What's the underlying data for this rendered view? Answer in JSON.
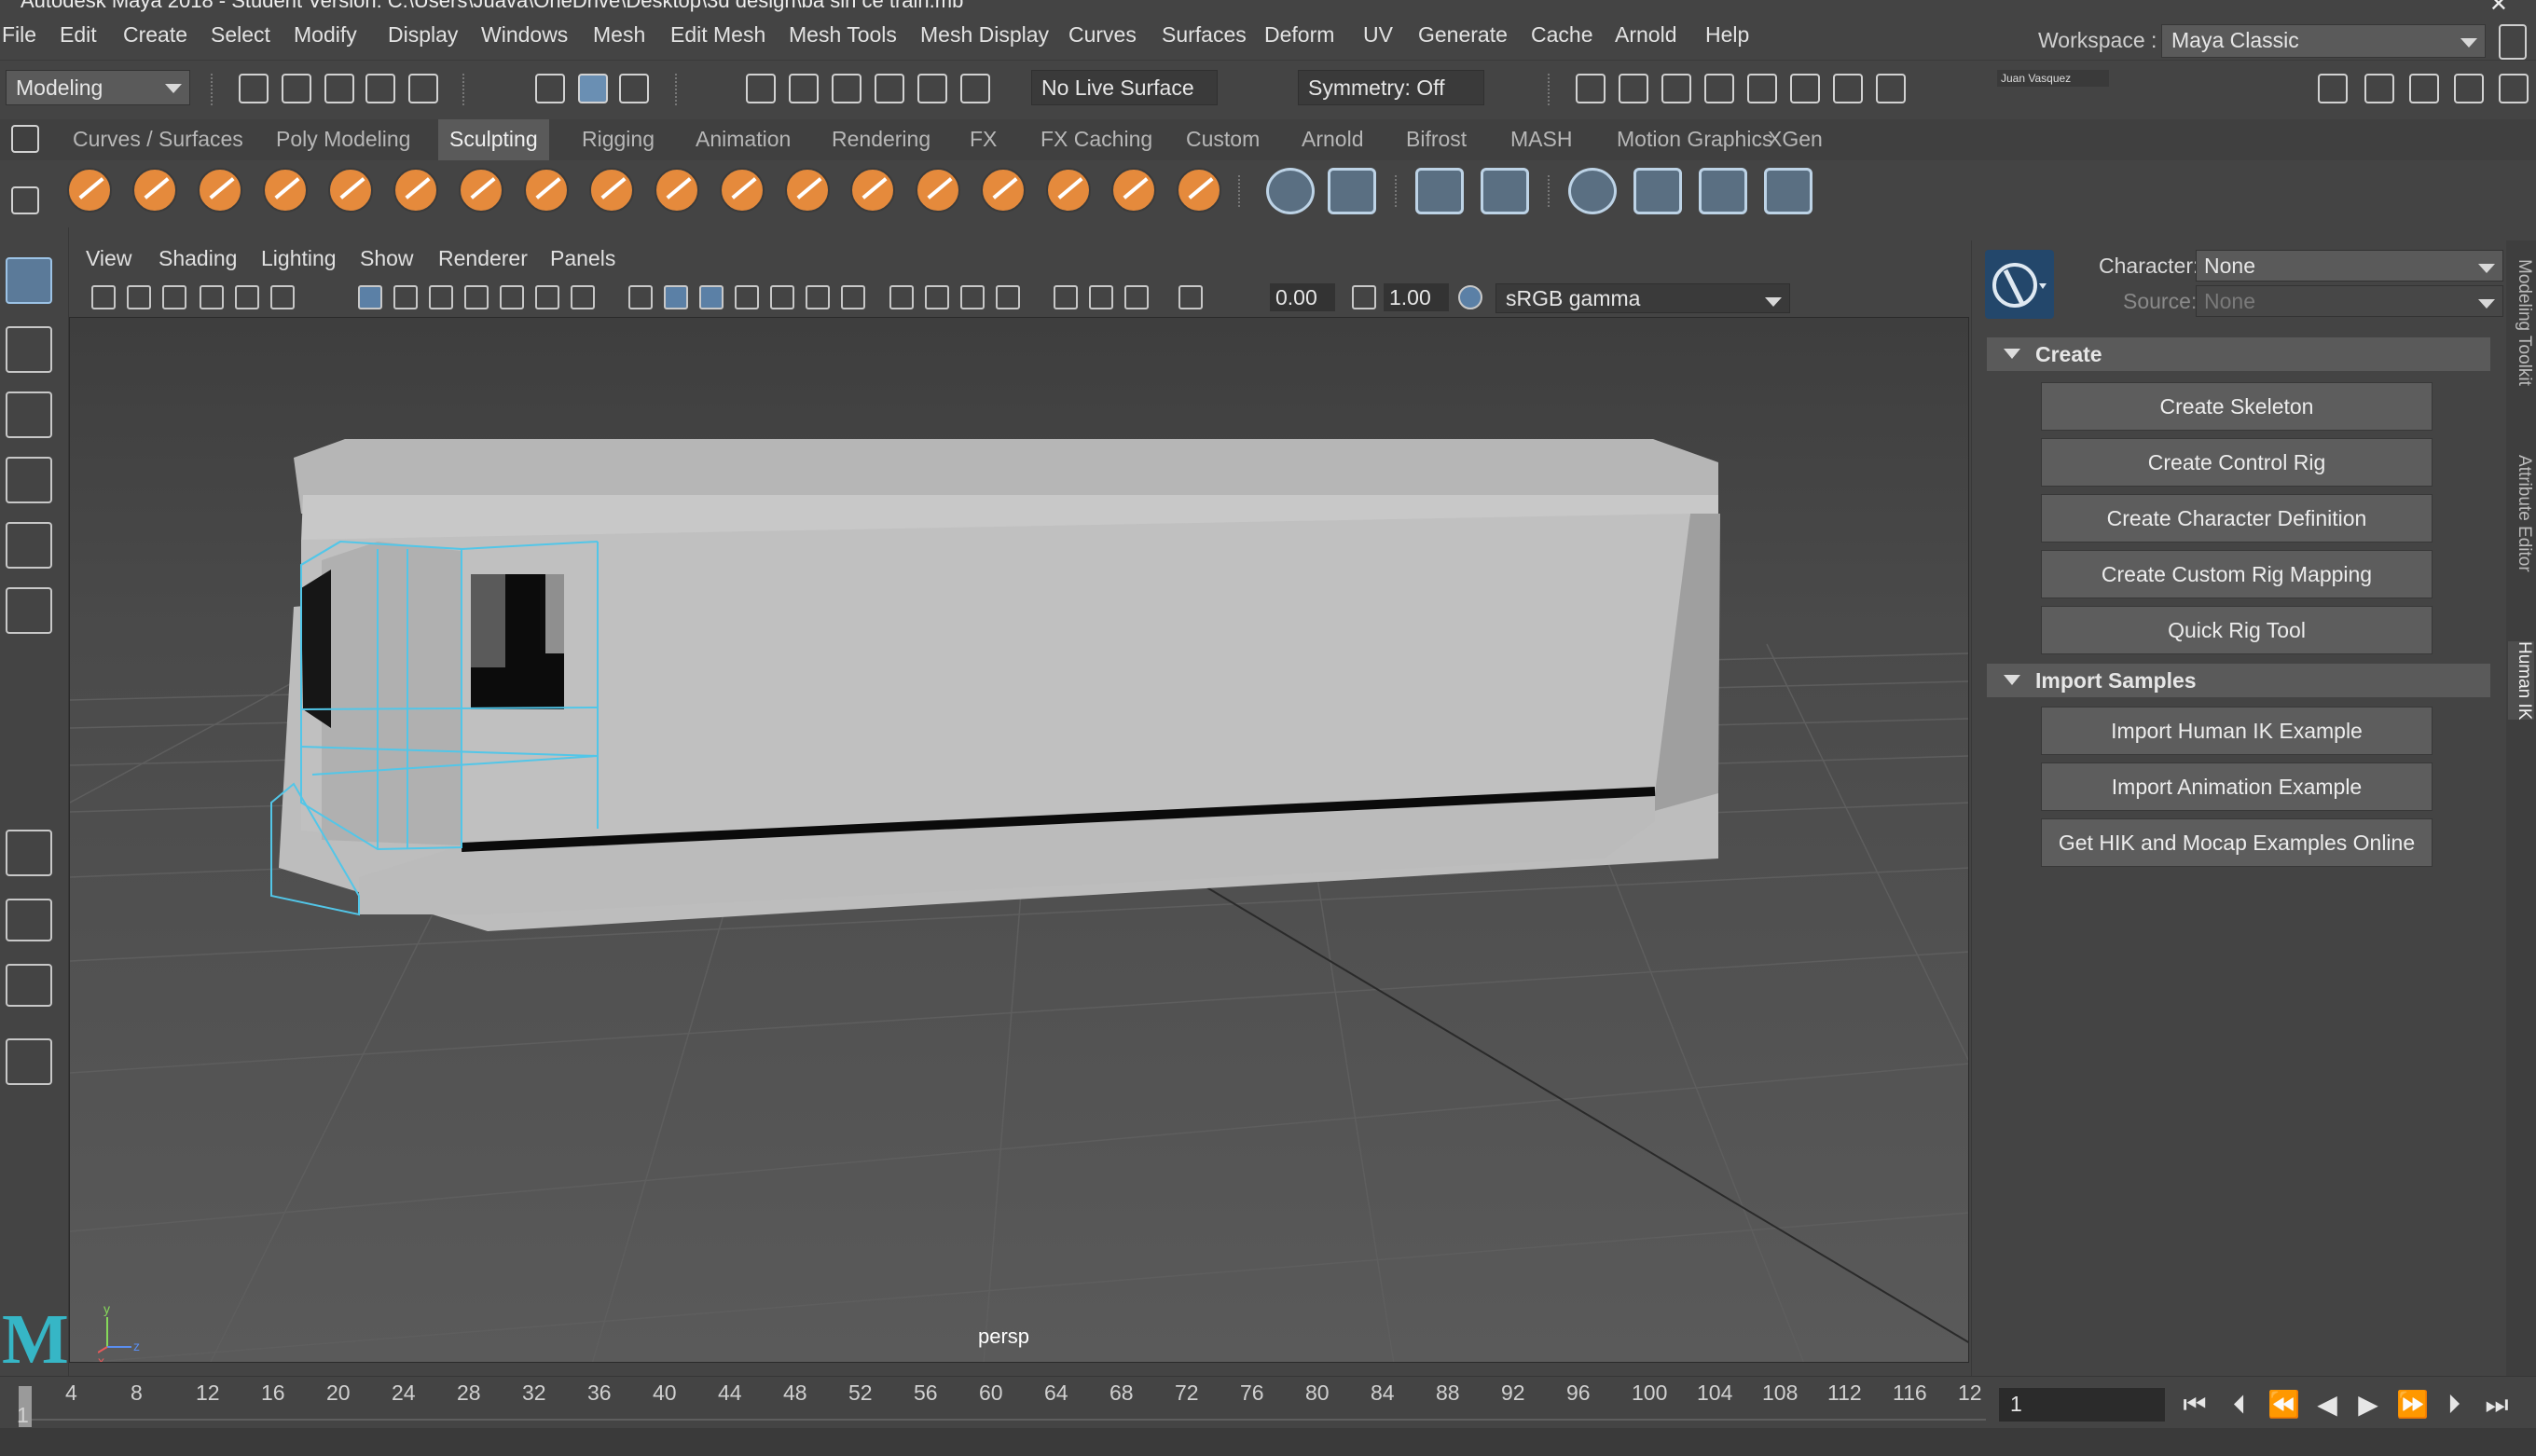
{
  "window": {
    "title": "Autodesk Maya 2018 - Student Version: C:\\Users\\Juava\\OneDrive\\Desktop\\3d design\\ba sin ce train.mb",
    "close_glyph": "✕"
  },
  "menubar": {
    "items": [
      "File",
      "Edit",
      "Create",
      "Select",
      "Modify",
      "Display",
      "Windows",
      "Mesh",
      "Edit Mesh",
      "Mesh Tools",
      "Mesh Display",
      "Curves",
      "Surfaces",
      "Deform",
      "UV",
      "Generate",
      "Cache",
      "Arnold",
      "Help"
    ],
    "workspace_label": "Workspace :",
    "workspace_value": "Maya Classic"
  },
  "statusline": {
    "mode": "Modeling",
    "live_surface": "No Live Surface",
    "symmetry": "Symmetry: Off",
    "user": "Juan Vasquez"
  },
  "shelf": {
    "tabs": [
      "Curves / Surfaces",
      "Poly Modeling",
      "Sculpting",
      "Rigging",
      "Animation",
      "Rendering",
      "FX",
      "FX Caching",
      "Custom",
      "Arnold",
      "Bifrost",
      "MASH",
      "Motion Graphics",
      "XGen"
    ],
    "active_tab": "Sculpting"
  },
  "viewport": {
    "menus": [
      "View",
      "Shading",
      "Lighting",
      "Show",
      "Renderer",
      "Panels"
    ],
    "exposure": "0.00",
    "gamma": "1.00",
    "color_space": "sRGB gamma",
    "camera_label": "persp",
    "axis": {
      "y": "y",
      "x": "x",
      "z": "z"
    }
  },
  "human_ik": {
    "character_label": "Character:",
    "character_value": "None",
    "source_label": "Source:",
    "source_value": "None",
    "create_header": "Create",
    "create_buttons": [
      "Create Skeleton",
      "Create Control Rig",
      "Create Character Definition",
      "Create Custom Rig Mapping",
      "Quick Rig Tool"
    ],
    "import_header": "Import Samples",
    "import_buttons": [
      "Import Human IK Example",
      "Import Animation Example",
      "Get HIK and Mocap Examples Online"
    ]
  },
  "side_tabs": [
    "Modeling Toolkit",
    "Attribute Editor",
    "Human IK"
  ],
  "timeline": {
    "ticks": [
      "4",
      "8",
      "12",
      "16",
      "20",
      "24",
      "28",
      "32",
      "36",
      "40",
      "44",
      "48",
      "52",
      "56",
      "60",
      "64",
      "68",
      "72",
      "76",
      "80",
      "84",
      "88",
      "92",
      "96",
      "100",
      "104",
      "108",
      "112",
      "116",
      "12"
    ],
    "start_marker": "1",
    "current_frame": "1"
  },
  "logo": "M",
  "colors": {
    "accent": "#5b7a99",
    "sculpt_orange": "#e58a3c",
    "wire_cyan": "#52c6e8",
    "maya_teal": "#36b6c6"
  }
}
